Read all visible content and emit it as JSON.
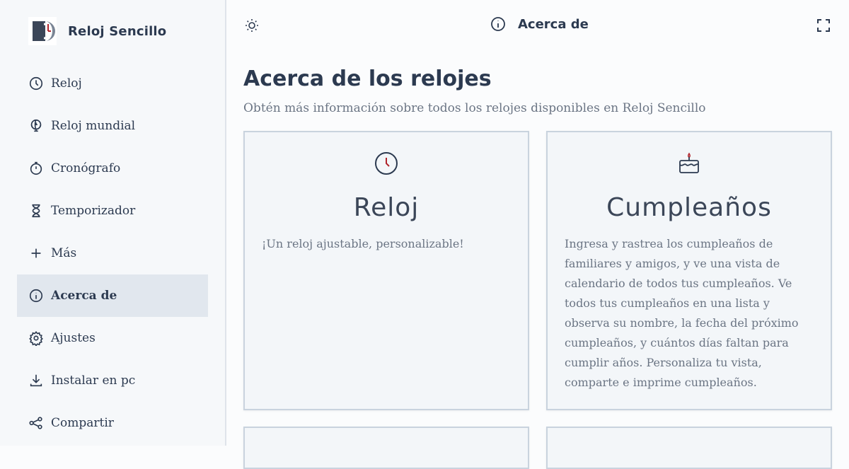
{
  "brand": {
    "name": "Reloj Sencillo"
  },
  "sidebar": {
    "items": [
      {
        "label": "Reloj",
        "icon": "clock-icon"
      },
      {
        "label": "Reloj mundial",
        "icon": "globe-clock-icon"
      },
      {
        "label": "Cronógrafo",
        "icon": "stopwatch-icon"
      },
      {
        "label": "Temporizador",
        "icon": "hourglass-icon"
      },
      {
        "label": "Más",
        "icon": "plus-icon"
      },
      {
        "label": "Acerca de",
        "icon": "info-icon",
        "active": true
      },
      {
        "label": "Ajustes",
        "icon": "gear-icon"
      },
      {
        "label": "Instalar en pc",
        "icon": "download-icon"
      },
      {
        "label": "Compartir",
        "icon": "share-icon"
      }
    ]
  },
  "topbar": {
    "title": "Acerca de"
  },
  "main": {
    "title": "Acerca de los relojes",
    "subtitle": "Obtén más información sobre todos los relojes disponibles en Reloj Sencillo",
    "cards": [
      {
        "title": "Reloj",
        "icon": "clock-icon",
        "description": "¡Un reloj ajustable, personalizable!"
      },
      {
        "title": "Cumpleaños",
        "icon": "cake-icon",
        "description": "Ingresa y rastrea los cumpleaños de familiares y amigos, y ve una vista de calendario de todos tus cumpleaños. Ve todos tus cumpleaños en una lista y observa su nombre, la fecha del próximo cumpleaños, y cuántos días faltan para cumplir años. Personaliza tu vista, comparte e imprime cumpleaños."
      }
    ]
  },
  "colors": {
    "text": "#2c3a50",
    "accent": "#b0232b",
    "active_bg": "#e1e7ee",
    "card_border": "#c9d3de"
  }
}
